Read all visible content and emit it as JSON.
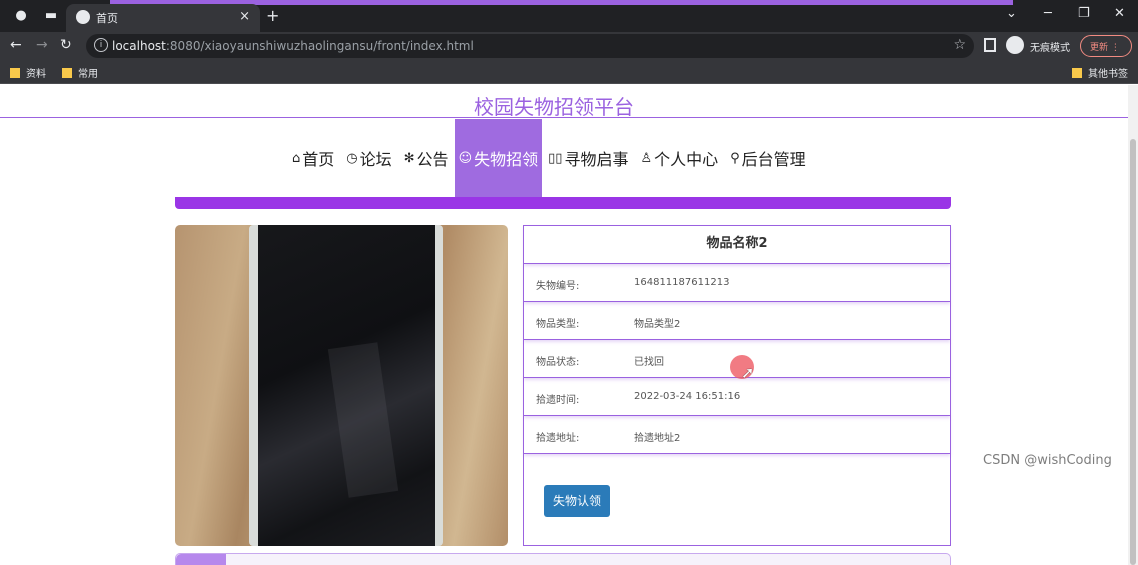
{
  "browser": {
    "tab_title": "首页",
    "tab_close": "×",
    "new_tab": "+",
    "url_host": "localhost",
    "url_path": ":8080/xiaoyaunshiwuzhaolingansu/front/index.html",
    "incognito_label": "无痕模式",
    "update_label": "更新 ⋮",
    "bookmarks": [
      "资料",
      "常用"
    ],
    "other_bookmarks": "其他书签"
  },
  "site": {
    "title": "校园失物招领平台",
    "nav": [
      {
        "icon": "⌂",
        "label": "首页"
      },
      {
        "icon": "◷",
        "label": "论坛"
      },
      {
        "icon": "✻",
        "label": "公告"
      },
      {
        "icon": "☺",
        "label": "失物招领"
      },
      {
        "icon": "▯▯",
        "label": "寻物启事"
      },
      {
        "icon": "♙",
        "label": "个人中心"
      },
      {
        "icon": "⚲",
        "label": "后台管理"
      }
    ],
    "active_nav": "失物招领"
  },
  "item": {
    "name": "物品名称2",
    "fields": [
      {
        "label": "失物编号:",
        "value": "164811187611213"
      },
      {
        "label": "物品类型:",
        "value": "物品类型2"
      },
      {
        "label": "物品状态:",
        "value": "已找回"
      },
      {
        "label": "拾遗时间:",
        "value": "2022-03-24 16:51:16"
      },
      {
        "label": "拾遗地址:",
        "value": "拾遗地址2"
      }
    ],
    "claim_button": "失物认领"
  },
  "watermark": "CSDN @wishCoding",
  "colors": {
    "accent": "#9b62e0",
    "band": "#9a35e6",
    "button": "#2b7bb9"
  }
}
